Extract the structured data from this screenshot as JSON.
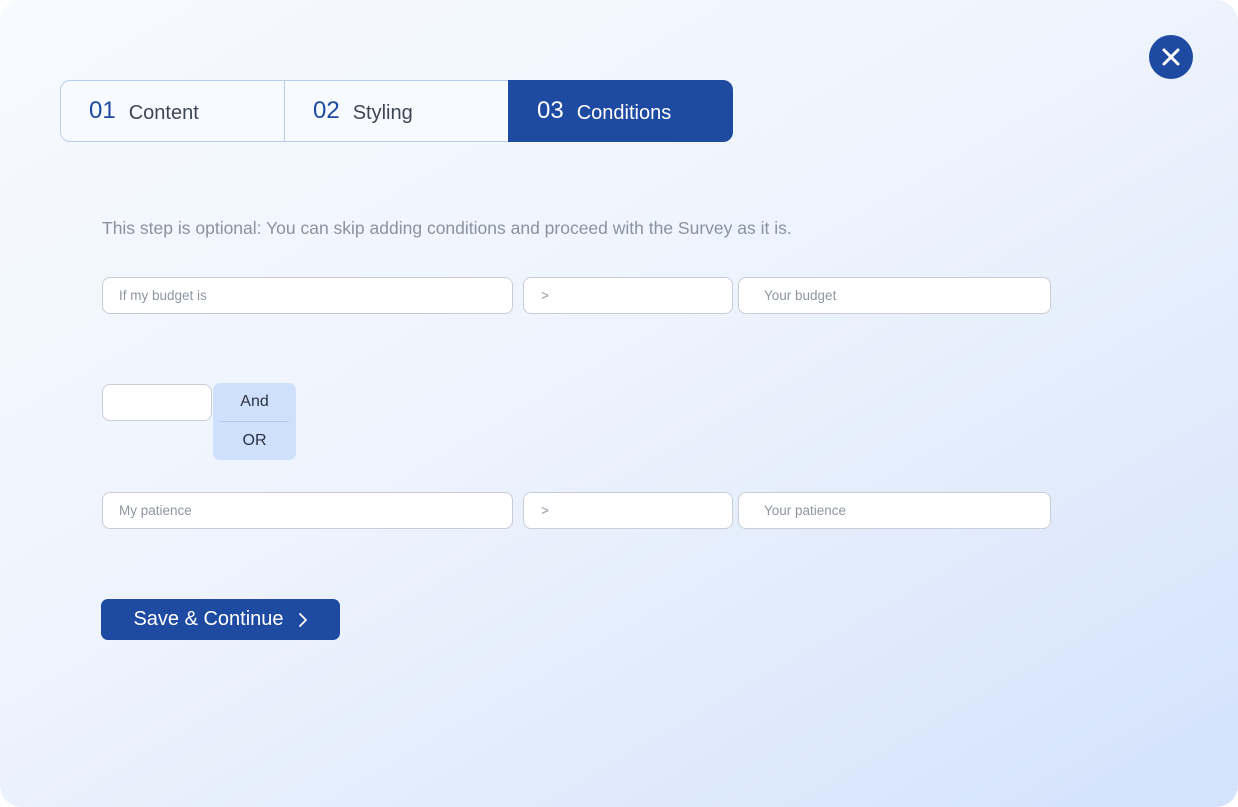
{
  "tabs": [
    {
      "number": "01",
      "label": "Content",
      "active": false
    },
    {
      "number": "02",
      "label": "Styling",
      "active": false
    },
    {
      "number": "03",
      "label": "Conditions",
      "active": true
    }
  ],
  "hint": "This step is optional: You can skip adding conditions and proceed with the Survey as it is.",
  "conditions": [
    {
      "field": "If my budget is",
      "operator": ">",
      "value": "Your budget"
    },
    {
      "field": "My patience",
      "operator": ">",
      "value": "Your  patience"
    }
  ],
  "logic": {
    "input_value": "",
    "options": [
      "And",
      "OR"
    ]
  },
  "save_button": {
    "label": "Save & Continue",
    "icon": "chevron-right-icon"
  },
  "close_button": {
    "icon": "close-icon"
  },
  "colors": {
    "primary": "#1f4aa1",
    "dropdown_bg": "#cfe0fc",
    "hint_text": "#8a929e"
  }
}
